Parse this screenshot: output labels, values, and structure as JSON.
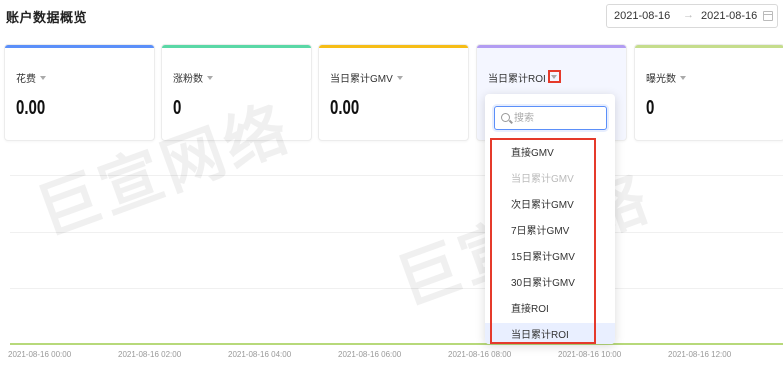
{
  "header": {
    "title": "账户数据概览"
  },
  "date_range": {
    "start": "2021-08-16",
    "separator": "→",
    "end": "2021-08-16"
  },
  "cards": [
    {
      "label": "花费",
      "value": "0.00",
      "color": "#5b8ff9"
    },
    {
      "label": "涨粉数",
      "value": "0",
      "color": "#5ad8a6"
    },
    {
      "label": "当日累计GMV",
      "value": "0.00",
      "color": "#f6bd16"
    },
    {
      "label": "当日累计ROI",
      "value": "",
      "color": "#b29cf2"
    },
    {
      "label": "曝光数",
      "value": "0",
      "color": "#c5dd8c"
    }
  ],
  "dropdown": {
    "search_placeholder": "搜索",
    "options": [
      {
        "label": "直接GMV",
        "state": "normal"
      },
      {
        "label": "当日累计GMV",
        "state": "disabled"
      },
      {
        "label": "次日累计GMV",
        "state": "normal"
      },
      {
        "label": "7日累计GMV",
        "state": "normal"
      },
      {
        "label": "15日累计GMV",
        "state": "normal"
      },
      {
        "label": "30日累计GMV",
        "state": "normal"
      },
      {
        "label": "直接ROI",
        "state": "normal"
      },
      {
        "label": "当日累计ROI",
        "state": "selected"
      }
    ]
  },
  "chart_data": {
    "type": "line",
    "x": [
      "2021-08-16 00:00",
      "2021-08-16 02:00",
      "2021-08-16 04:00",
      "2021-08-16 06:00",
      "2021-08-16 08:00",
      "2021-08-16 10:00",
      "2021-08-16 12:00"
    ],
    "series": [
      {
        "values": [
          0,
          0,
          0,
          0,
          0,
          0,
          0
        ]
      }
    ]
  },
  "watermark": {
    "text": "巨宣网络"
  }
}
